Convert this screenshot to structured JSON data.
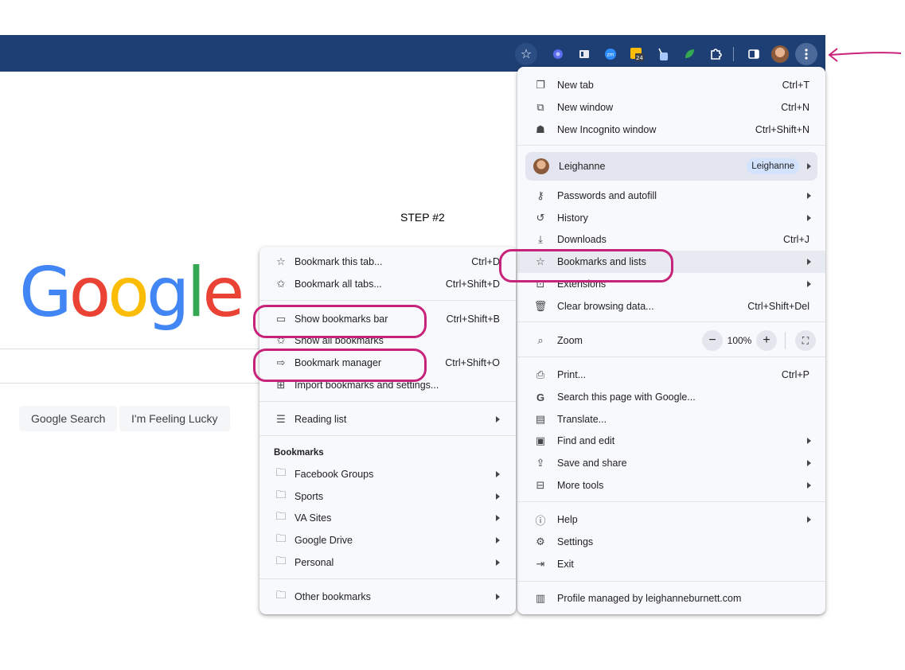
{
  "annotation": {
    "step_label": "STEP #2",
    "accent_color": "#c8237a"
  },
  "toolbar": {
    "bg_color": "#1e3f74",
    "icons": [
      "star-icon",
      "extension-puzzle-blue-icon",
      "extension-board-icon",
      "zoom-icon",
      "calendar-24-icon",
      "extension-pen-icon",
      "extension-leaf-icon",
      "extensions-puzzle-icon",
      "side-panel-icon",
      "profile-avatar",
      "kebab-menu-icon"
    ],
    "calendar_badge": "24",
    "zoom_badge": "zm"
  },
  "google": {
    "logo_letters": [
      "G",
      "o",
      "o",
      "g",
      "l",
      "e"
    ],
    "logo_colors": [
      "#4285f4",
      "#ea4335",
      "#fbbc05",
      "#4285f4",
      "#34a853",
      "#ea4335"
    ],
    "search_button": "Google Search",
    "lucky_button": "I'm Feeling Lucky"
  },
  "main_menu": {
    "new_tab": {
      "label": "New tab",
      "shortcut": "Ctrl+T"
    },
    "new_window": {
      "label": "New window",
      "shortcut": "Ctrl+N"
    },
    "new_incognito": {
      "label": "New Incognito window",
      "shortcut": "Ctrl+Shift+N"
    },
    "profile": {
      "name": "Leighanne",
      "chip": "Leighanne"
    },
    "passwords": {
      "label": "Passwords and autofill"
    },
    "history": {
      "label": "History"
    },
    "downloads": {
      "label": "Downloads",
      "shortcut": "Ctrl+J"
    },
    "bookmarks": {
      "label": "Bookmarks and lists"
    },
    "extensions": {
      "label": "Extensions"
    },
    "clear_data": {
      "label": "Clear browsing data...",
      "shortcut": "Ctrl+Shift+Del"
    },
    "zoom": {
      "label": "Zoom",
      "minus": "−",
      "value": "100%",
      "plus": "+"
    },
    "print": {
      "label": "Print...",
      "shortcut": "Ctrl+P"
    },
    "search_page": {
      "label": "Search this page with Google..."
    },
    "translate": {
      "label": "Translate..."
    },
    "find_edit": {
      "label": "Find and edit"
    },
    "save_share": {
      "label": "Save and share"
    },
    "more_tools": {
      "label": "More tools"
    },
    "help": {
      "label": "Help"
    },
    "settings": {
      "label": "Settings"
    },
    "exit": {
      "label": "Exit"
    },
    "managed": {
      "label": "Profile managed by leighanneburnett.com"
    }
  },
  "bookmarks_menu": {
    "bookmark_tab": {
      "label": "Bookmark this tab...",
      "shortcut": "Ctrl+D"
    },
    "bookmark_all": {
      "label": "Bookmark all tabs...",
      "shortcut": "Ctrl+Shift+D"
    },
    "show_bar": {
      "label": "Show bookmarks bar",
      "shortcut": "Ctrl+Shift+B"
    },
    "show_all": {
      "label": "Show all bookmarks"
    },
    "manager": {
      "label": "Bookmark manager",
      "shortcut": "Ctrl+Shift+O"
    },
    "import": {
      "label": "Import bookmarks and settings..."
    },
    "reading_list": {
      "label": "Reading list"
    },
    "heading": "Bookmarks",
    "folders": [
      "Facebook Groups",
      "Sports",
      "VA Sites",
      "Google Drive",
      "Personal"
    ],
    "other": "Other bookmarks"
  }
}
